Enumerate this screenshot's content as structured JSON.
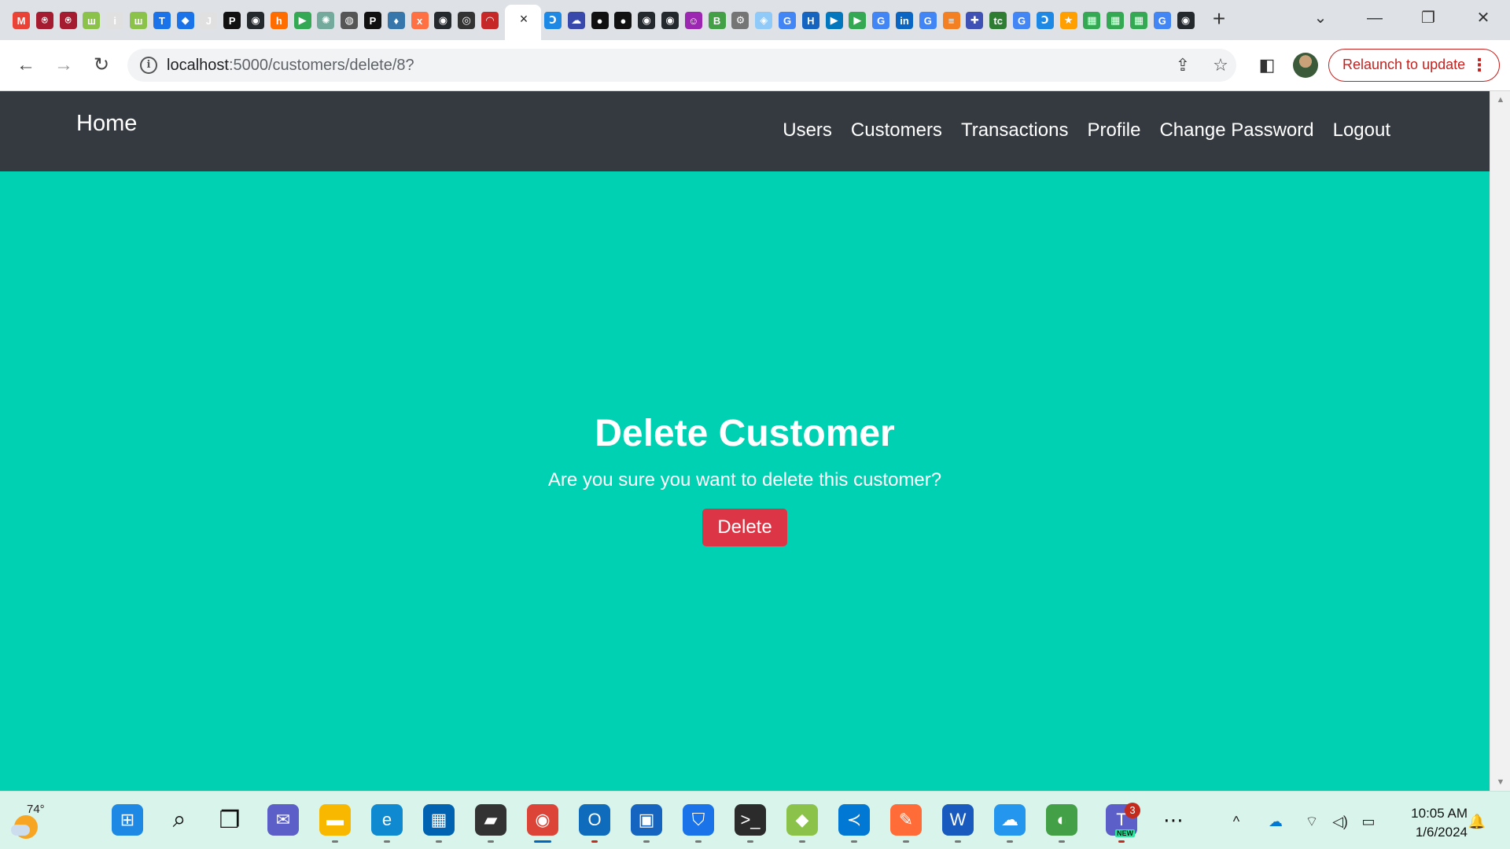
{
  "browser": {
    "url_host": "localhost",
    "url_path": ":5000/customers/delete/8?",
    "relaunch_label": "Relaunch to update",
    "relaunch_menu": "⋮",
    "tab_close": "×",
    "new_tab": "+",
    "win_controls": [
      "⌄",
      "—",
      "❐",
      "✕"
    ],
    "back": "←",
    "forward": "→",
    "reload": "↻",
    "info": "i",
    "share": "⇪",
    "star": "☆",
    "side_panel": "◧",
    "favicons": [
      {
        "name": "gmail-icon",
        "color": "#ea4335",
        "glyph": "M"
      },
      {
        "name": "app-red-icon",
        "color": "#a51c30",
        "glyph": "⍟"
      },
      {
        "name": "app-red2-icon",
        "color": "#a51c30",
        "glyph": "⍟"
      },
      {
        "name": "app-green-icon",
        "color": "#8bc34a",
        "glyph": "ш"
      },
      {
        "name": "info-site-icon",
        "color": "#e0e0e0",
        "glyph": "i"
      },
      {
        "name": "app-green2-icon",
        "color": "#8bc34a",
        "glyph": "ш"
      },
      {
        "name": "t-icon",
        "color": "#1a73e8",
        "glyph": "T"
      },
      {
        "name": "jira-icon",
        "color": "#1a73e8",
        "glyph": "◆"
      },
      {
        "name": "j2c-icon",
        "color": "#e0e0e0",
        "glyph": "J"
      },
      {
        "name": "p-icon",
        "color": "#111111",
        "glyph": "P"
      },
      {
        "name": "github-icon",
        "color": "#24292e",
        "glyph": "◉"
      },
      {
        "name": "app-orange-icon",
        "color": "#ff6d00",
        "glyph": "h"
      },
      {
        "name": "meet-icon",
        "color": "#34a853",
        "glyph": "▶"
      },
      {
        "name": "openai-icon",
        "color": "#74aa9c",
        "glyph": "✺"
      },
      {
        "name": "globe-icon",
        "color": "#555555",
        "glyph": "◍"
      },
      {
        "name": "p2-icon",
        "color": "#111111",
        "glyph": "P"
      },
      {
        "name": "python-icon",
        "color": "#3776ab",
        "glyph": "♦"
      },
      {
        "name": "app-x-icon",
        "color": "#ff7043",
        "glyph": "x"
      },
      {
        "name": "github2-icon",
        "color": "#24292e",
        "glyph": "◉"
      },
      {
        "name": "app-bw-icon",
        "color": "#333333",
        "glyph": "◎"
      },
      {
        "name": "app-arc-icon",
        "color": "#c62828",
        "glyph": "◠"
      }
    ],
    "favicons_right": [
      {
        "name": "app-swirl-icon",
        "color": "#1e88e5",
        "glyph": "Ↄ"
      },
      {
        "name": "cloud-icon",
        "color": "#3949ab",
        "glyph": "☁"
      },
      {
        "name": "medium-icon",
        "color": "#111111",
        "glyph": "●"
      },
      {
        "name": "medium2-icon",
        "color": "#111111",
        "glyph": "●"
      },
      {
        "name": "github3-icon",
        "color": "#24292e",
        "glyph": "◉"
      },
      {
        "name": "github4-icon",
        "color": "#24292e",
        "glyph": "◉"
      },
      {
        "name": "bot-icon",
        "color": "#9c27b0",
        "glyph": "☺"
      },
      {
        "name": "b64-icon",
        "color": "#43a047",
        "glyph": "B"
      },
      {
        "name": "gear-site-icon",
        "color": "#757575",
        "glyph": "⚙"
      },
      {
        "name": "shield-site-icon",
        "color": "#90caf9",
        "glyph": "◈"
      },
      {
        "name": "google-icon",
        "color": "#4285f4",
        "glyph": "G"
      },
      {
        "name": "hst-icon",
        "color": "#1565c0",
        "glyph": "H"
      },
      {
        "name": "video-icon",
        "color": "#0277bd",
        "glyph": "▶"
      },
      {
        "name": "meet2-icon",
        "color": "#34a853",
        "glyph": "▶"
      },
      {
        "name": "google2-icon",
        "color": "#4285f4",
        "glyph": "G"
      },
      {
        "name": "linkedin-icon",
        "color": "#0a66c2",
        "glyph": "in"
      },
      {
        "name": "google3-icon",
        "color": "#4285f4",
        "glyph": "G"
      },
      {
        "name": "stack-icon",
        "color": "#f48024",
        "glyph": "≡"
      },
      {
        "name": "app-puzzle-icon",
        "color": "#3f51b5",
        "glyph": "✚"
      },
      {
        "name": "tc-icon",
        "color": "#2e7d32",
        "glyph": "tc"
      },
      {
        "name": "google4-icon",
        "color": "#4285f4",
        "glyph": "G"
      },
      {
        "name": "app-swirl2-icon",
        "color": "#1e88e5",
        "glyph": "Ↄ"
      },
      {
        "name": "star-site-icon",
        "color": "#ffa000",
        "glyph": "★"
      },
      {
        "name": "sheet-icon",
        "color": "#34a853",
        "glyph": "▦"
      },
      {
        "name": "sheet2-icon",
        "color": "#34a853",
        "glyph": "▦"
      },
      {
        "name": "sheet3-icon",
        "color": "#34a853",
        "glyph": "▦"
      },
      {
        "name": "google5-icon",
        "color": "#4285f4",
        "glyph": "G"
      },
      {
        "name": "github5-icon",
        "color": "#24292e",
        "glyph": "◉"
      }
    ]
  },
  "navbar": {
    "brand": "Home",
    "links": [
      "Users",
      "Customers",
      "Transactions",
      "Profile",
      "Change Password",
      "Logout"
    ]
  },
  "page": {
    "title": "Delete Customer",
    "message": "Are you sure you want to delete this customer?",
    "delete_label": "Delete"
  },
  "colors": {
    "page_bg": "#00d1b2",
    "navbar_bg": "#343a40",
    "danger": "#dc3545"
  },
  "taskbar": {
    "temperature": "74°",
    "time": "10:05 AM",
    "date": "1/6/2024",
    "apps": [
      {
        "name": "start-icon",
        "color": "#1e88e5",
        "glyph": "⊞"
      },
      {
        "name": "search-icon",
        "color": "transparent",
        "glyph": "⌕"
      },
      {
        "name": "task-view-icon",
        "color": "transparent",
        "glyph": "❐"
      },
      {
        "name": "teams-chat-icon",
        "color": "#5b5fc7",
        "glyph": "✉"
      },
      {
        "name": "file-explorer-icon",
        "color": "#f9b800",
        "glyph": "▬"
      },
      {
        "name": "edge-icon",
        "color": "#0f8ad0",
        "glyph": "e"
      },
      {
        "name": "store-icon",
        "color": "#0063b1",
        "glyph": "▦"
      },
      {
        "name": "terminal-tool-icon",
        "color": "#333333",
        "glyph": "▰"
      },
      {
        "name": "chrome-icon",
        "color": "#db4437",
        "glyph": "◉"
      },
      {
        "name": "outlook-icon",
        "color": "#0f6cbd",
        "glyph": "O"
      },
      {
        "name": "remote-desktop-icon",
        "color": "#1565c0",
        "glyph": "▣"
      },
      {
        "name": "defender-icon",
        "color": "#1a73e8",
        "glyph": "⛉"
      },
      {
        "name": "terminal-icon",
        "color": "#2b2b2b",
        "glyph": ">_"
      },
      {
        "name": "git-icon",
        "color": "#8bc34a",
        "glyph": "◆"
      },
      {
        "name": "vscode-icon",
        "color": "#0078d4",
        "glyph": "≺"
      },
      {
        "name": "postman-icon",
        "color": "#ff6c37",
        "glyph": "✎"
      },
      {
        "name": "word-icon",
        "color": "#185abd",
        "glyph": "W"
      },
      {
        "name": "docker-icon",
        "color": "#2496ed",
        "glyph": "☁"
      },
      {
        "name": "app-globe-icon",
        "color": "#43a047",
        "glyph": "◐"
      },
      {
        "name": "teams-icon",
        "color": "#5b5fc7",
        "glyph": "T"
      }
    ],
    "teams_badge": "3",
    "teams_new": "NEW",
    "more": "⋯",
    "tray": [
      "^",
      "☁",
      "⌔",
      "◁)",
      "▭",
      "🔔"
    ]
  }
}
